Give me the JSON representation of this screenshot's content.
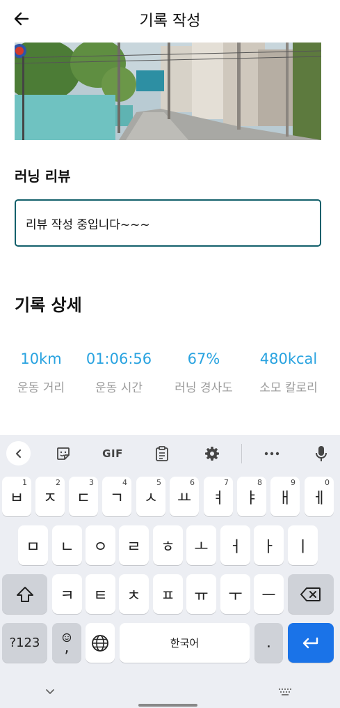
{
  "header": {
    "title": "기록 작성"
  },
  "review": {
    "label": "러닝 리뷰",
    "value": "리뷰 작성 중입니다~~~"
  },
  "details": {
    "title": "기록 상세",
    "stats": [
      {
        "value": "10km",
        "label": "운동 거리"
      },
      {
        "value": "01:06:56",
        "label": "운동 시간"
      },
      {
        "value": "67%",
        "label": "러닝 경사도"
      },
      {
        "value": "480kcal",
        "label": "소모 칼로리"
      }
    ]
  },
  "keyboard": {
    "toolbar": {
      "gif_label": "GIF"
    },
    "row1": [
      {
        "char": "ㅂ",
        "hint": "1"
      },
      {
        "char": "ㅈ",
        "hint": "2"
      },
      {
        "char": "ㄷ",
        "hint": "3"
      },
      {
        "char": "ㄱ",
        "hint": "4"
      },
      {
        "char": "ㅅ",
        "hint": "5"
      },
      {
        "char": "ㅛ",
        "hint": "6"
      },
      {
        "char": "ㅕ",
        "hint": "7"
      },
      {
        "char": "ㅑ",
        "hint": "8"
      },
      {
        "char": "ㅐ",
        "hint": "9"
      },
      {
        "char": "ㅔ",
        "hint": "0"
      }
    ],
    "row2": [
      "ㅁ",
      "ㄴ",
      "ㅇ",
      "ㄹ",
      "ㅎ",
      "ㅗ",
      "ㅓ",
      "ㅏ",
      "ㅣ"
    ],
    "row3": [
      "ㅋ",
      "ㅌ",
      "ㅊ",
      "ㅍ",
      "ㅠ",
      "ㅜ",
      "ㅡ"
    ],
    "symbols_label": "?123",
    "emoji_comma": ",",
    "space_label": "한국어",
    "period": "."
  },
  "colors": {
    "accent": "#29a3e0",
    "input_border": "#13606b",
    "enter_key": "#1a73e8"
  }
}
